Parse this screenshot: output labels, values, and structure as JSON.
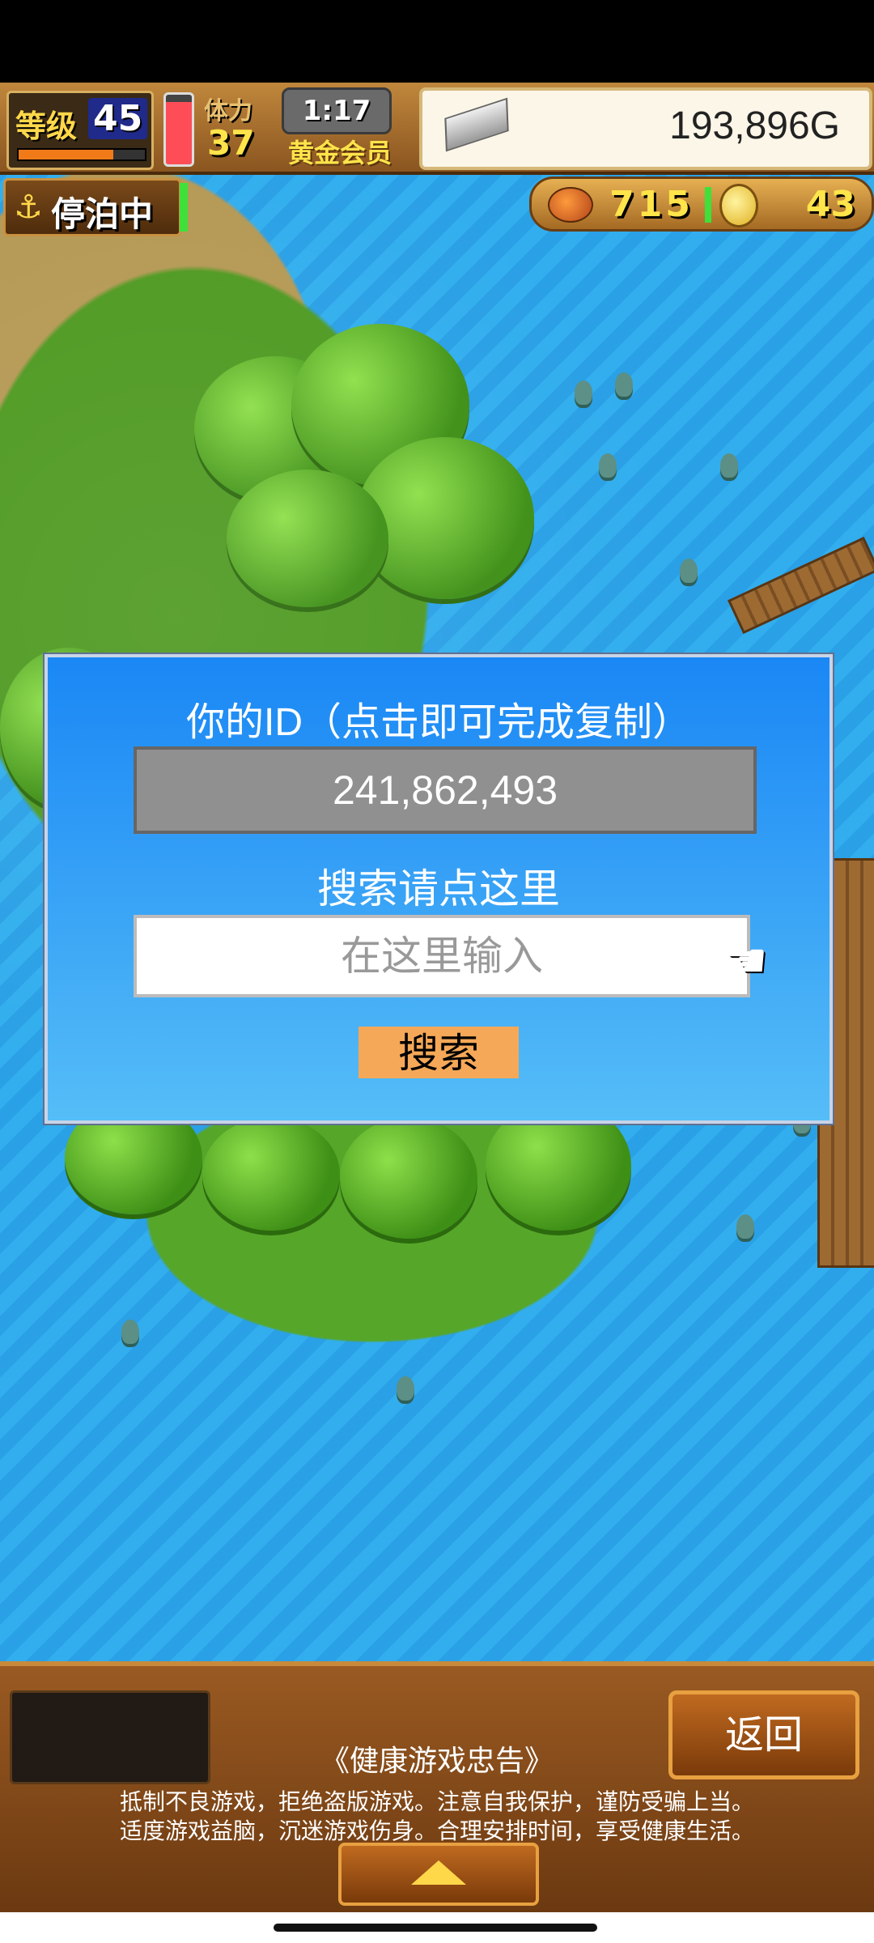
{
  "hud": {
    "level_label": "等级",
    "level_value": "45",
    "level_progress": 0.75,
    "hp_fill": 0.9,
    "stamina_label": "体力",
    "stamina_value": "37",
    "timer": "1:17",
    "membership": "黄金会员",
    "gold": "193,896G",
    "anchor_label": "停泊中",
    "resource_1": "715",
    "resource_2": "43"
  },
  "dialog": {
    "title": "你的ID（点击即可完成复制）",
    "id_value": "241,862,493",
    "search_label": "搜索请点这里",
    "search_placeholder": "在这里输入",
    "search_button": "搜索"
  },
  "bottom": {
    "back_button": "返回",
    "notice_title": "《健康游戏忠告》",
    "notice_line_1": "抵制不良游戏，拒绝盗版游戏。注意自我保护，谨防受骗上当。",
    "notice_line_2": "适度游戏益脑，沉迷游戏伤身。合理安排时间，享受健康生活。"
  },
  "colors": {
    "dialog_top": "#1a87f5",
    "dialog_bottom": "#55bdf7",
    "search_button": "#f4a858",
    "id_box": "#909090"
  }
}
